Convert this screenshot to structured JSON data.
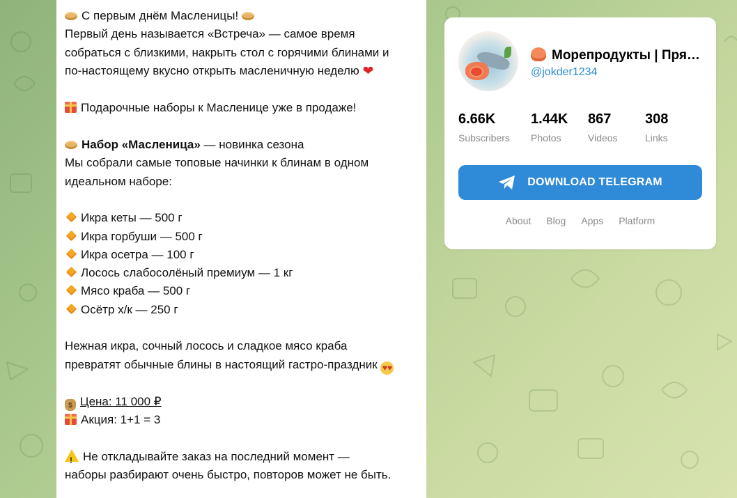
{
  "post": {
    "line1": "С первым днём Масленицы!",
    "line2": "Первый день называется «Встреча» — самое время",
    "line3": "собраться с близкими, накрыть стол с горячими блинами и",
    "line4": "по-настоящему вкусно открыть масленичную неделю",
    "gift_line": "Подарочные наборы к Масленице уже в продаже!",
    "set_title": "Набор «Масленица»",
    "set_subtitle": " — новинка сезона",
    "set_desc1": "Мы собрали самые топовые начинки к блинам в одном",
    "set_desc2": "идеальном наборе:",
    "items": [
      "Икра кеты — 500 г",
      "Икра горбуши — 500 г",
      "Икра осетра — 100 г",
      "Лосось слабосолёный премиум — 1 кг",
      "Мясо краба — 500 г",
      "Осётр х/к — 250 г"
    ],
    "tasty1": "Нежная икра, сочный лосось и сладкое мясо краба",
    "tasty2": "превратят обычные блины в настоящий гастро-праздник",
    "price": "Цена: 11 000 ₽",
    "promo": "Акция: 1+1 = 3",
    "warn1": "Не откладывайте заказ на последний момент —",
    "warn2": "наборы разбирают очень быстро, повторов может не быть."
  },
  "channel": {
    "title": "Морепродукты | Пря…",
    "username": "@jokder1234",
    "stats": [
      {
        "value": "6.66K",
        "label": "Subscribers"
      },
      {
        "value": "1.44K",
        "label": "Photos"
      },
      {
        "value": "867",
        "label": "Videos"
      },
      {
        "value": "308",
        "label": "Links"
      }
    ],
    "download_label": "DOWNLOAD TELEGRAM",
    "links": [
      "About",
      "Blog",
      "Apps",
      "Platform"
    ]
  },
  "colors": {
    "accent": "#2f8ad8",
    "username": "#2a8bd1",
    "muted": "#8a8a8a"
  }
}
